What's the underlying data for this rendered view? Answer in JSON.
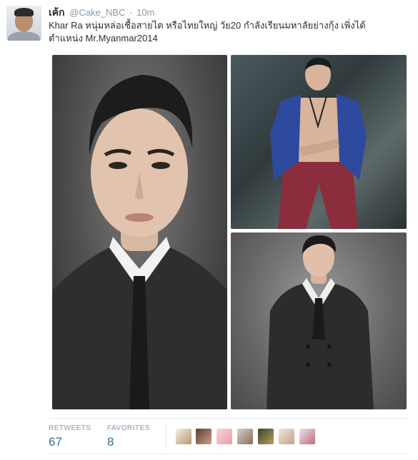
{
  "tweet": {
    "author_name": "เค้ก",
    "author_handle": "@Cake_NBC",
    "separator": "·",
    "time": "10m",
    "text_line1": "Khar Ra หนุ่มหล่อเชื้อสายไต หรือไทยใหญ่ วัย20 กำลังเรียนมหาลัยย่างกุ้ง เพิ่งได้",
    "text_line2": "ตำแหน่ง Mr.Myanmar2014"
  },
  "stats": {
    "retweets_label": "RETWEETS",
    "retweets_value": "67",
    "favorites_label": "FAVORITES",
    "favorites_value": "8"
  },
  "colors": {
    "link_blue": "#3b6e8f",
    "muted": "#8899a6",
    "text": "#292f33"
  }
}
